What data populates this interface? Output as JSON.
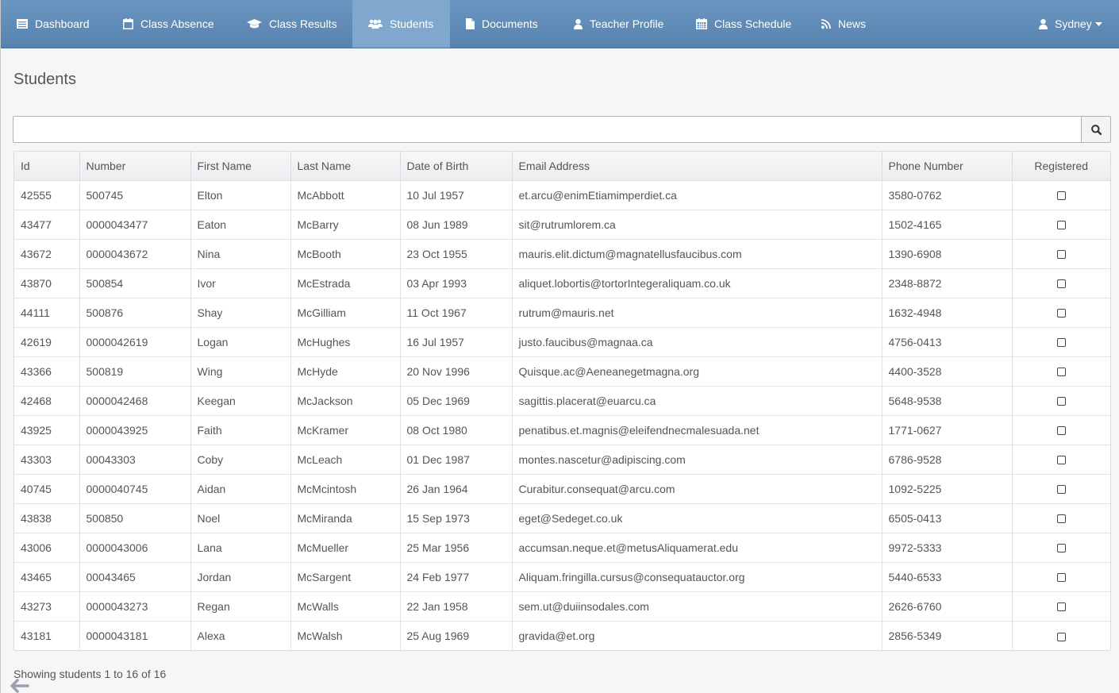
{
  "nav": {
    "items": [
      {
        "label": "Dashboard",
        "icon": "dashboard-icon"
      },
      {
        "label": "Class Absence",
        "icon": "calendar-icon"
      },
      {
        "label": "Class Results",
        "icon": "graduation-cap-icon"
      },
      {
        "label": "Students",
        "icon": "users-icon",
        "active": true
      },
      {
        "label": "Documents",
        "icon": "file-icon"
      },
      {
        "label": "Teacher Profile",
        "icon": "user-icon"
      },
      {
        "label": "Class Schedule",
        "icon": "calendar-grid-icon"
      },
      {
        "label": "News",
        "icon": "rss-icon"
      }
    ],
    "user": {
      "label": "Sydney",
      "icon": "user-icon"
    }
  },
  "page": {
    "title": "Students"
  },
  "search": {
    "value": "",
    "placeholder": ""
  },
  "table": {
    "columns": [
      "Id",
      "Number",
      "First Name",
      "Last Name",
      "Date of Birth",
      "Email Address",
      "Phone Number",
      "Registered"
    ],
    "rows": [
      [
        "42555",
        "500745",
        "Elton",
        "McAbbott",
        "10 Jul 1957",
        "et.arcu@enimEtiamimperdiet.ca",
        "3580-0762"
      ],
      [
        "43477",
        "0000043477",
        "Eaton",
        "McBarry",
        "08 Jun 1989",
        "sit@rutrumlorem.ca",
        "1502-4165"
      ],
      [
        "43672",
        "0000043672",
        "Nina",
        "McBooth",
        "23 Oct 1955",
        "mauris.elit.dictum@magnatellusfaucibus.com",
        "1390-6908"
      ],
      [
        "43870",
        "500854",
        "Ivor",
        "McEstrada",
        "03 Apr 1993",
        "aliquet.lobortis@tortorIntegeraliquam.co.uk",
        "2348-8872"
      ],
      [
        "44111",
        "500876",
        "Shay",
        "McGilliam",
        "11 Oct 1967",
        "rutrum@mauris.net",
        "1632-4948"
      ],
      [
        "42619",
        "0000042619",
        "Logan",
        "McHughes",
        "16 Jul 1957",
        "justo.faucibus@magnaa.ca",
        "4756-0413"
      ],
      [
        "43366",
        "500819",
        "Wing",
        "McHyde",
        "20 Nov 1996",
        "Quisque.ac@Aeneanegetmagna.org",
        "4400-3528"
      ],
      [
        "42468",
        "0000042468",
        "Keegan",
        "McJackson",
        "05 Dec 1969",
        "sagittis.placerat@euarcu.ca",
        "5648-9538"
      ],
      [
        "43925",
        "0000043925",
        "Faith",
        "McKramer",
        "08 Oct 1980",
        "penatibus.et.magnis@eleifendnecmalesuada.net",
        "1771-0627"
      ],
      [
        "43303",
        "00043303",
        "Coby",
        "McLeach",
        "01 Dec 1987",
        "montes.nascetur@adipiscing.com",
        "6786-9528"
      ],
      [
        "40745",
        "0000040745",
        "Aidan",
        "McMcintosh",
        "26 Jan 1964",
        "Curabitur.consequat@arcu.com",
        "1092-5225"
      ],
      [
        "43838",
        "500850",
        "Noel",
        "McMiranda",
        "15 Sep 1973",
        "eget@Sedeget.co.uk",
        "6505-0413"
      ],
      [
        "43006",
        "0000043006",
        "Lana",
        "McMueller",
        "25 Mar 1956",
        "accumsan.neque.et@metusAliquamerat.edu",
        "9972-5333"
      ],
      [
        "43465",
        "00043465",
        "Jordan",
        "McSargent",
        "24 Feb 1977",
        "Aliquam.fringilla.cursus@consequatauctor.org",
        "5440-6533"
      ],
      [
        "43273",
        "0000043273",
        "Regan",
        "McWalls",
        "22 Jan 1958",
        "sem.ut@duiinsodales.com",
        "2626-6760"
      ],
      [
        "43181",
        "0000043181",
        "Alexa",
        "McWalsh",
        "25 Aug 1969",
        "gravida@et.org",
        "2856-5349"
      ]
    ],
    "registered": [
      false,
      false,
      false,
      false,
      false,
      false,
      false,
      false,
      false,
      false,
      false,
      false,
      false,
      false,
      false,
      false
    ]
  },
  "footer": {
    "status": "Showing students 1 to 16 of 16"
  },
  "colors": {
    "navbar": "#6b96c1",
    "navbar_active": "#80a7cd",
    "text": "#555555"
  }
}
